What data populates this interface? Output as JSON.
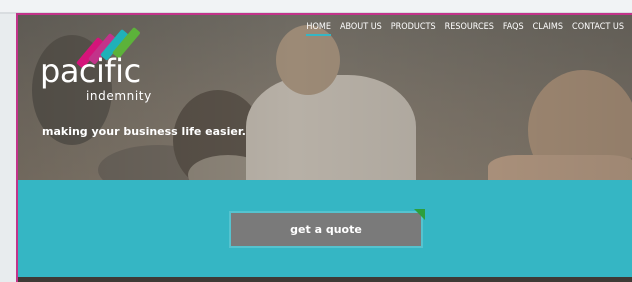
{
  "brand": {
    "name": "pacific",
    "sub": "indemnity",
    "stripe_colors": [
      "#d4147a",
      "#c2338a",
      "#1fb1b8",
      "#5cb23a"
    ]
  },
  "nav": {
    "items": [
      {
        "label": "HOME",
        "active": true
      },
      {
        "label": "ABOUT US"
      },
      {
        "label": "PRODUCTS"
      },
      {
        "label": "RESOURCES"
      },
      {
        "label": "FAQS"
      },
      {
        "label": "CLAIMS"
      },
      {
        "label": "CONTACT US"
      }
    ]
  },
  "hero": {
    "tagline": "making your business life easier."
  },
  "cta": {
    "label": "get a quote"
  },
  "colors": {
    "accent": "#35b6c4",
    "frame": "#c2338a",
    "button": "#7a7a7a",
    "button_corner": "#2d9f3c"
  }
}
